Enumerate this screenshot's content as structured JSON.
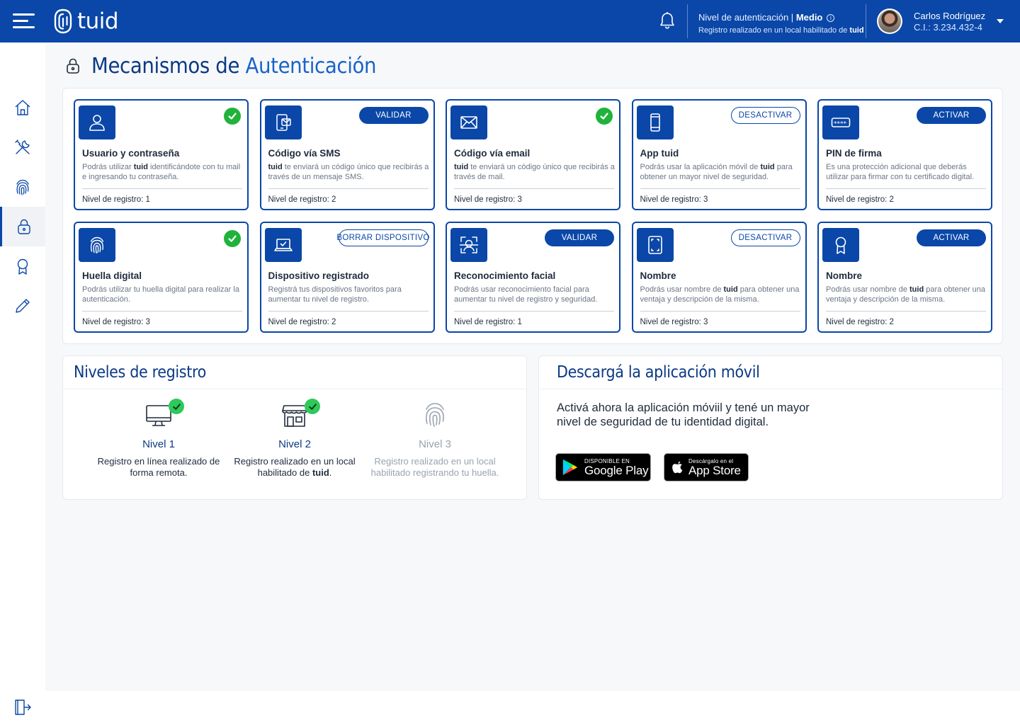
{
  "header": {
    "logo_text": "tuid",
    "auth_level_label": "Nivel de autenticación |",
    "auth_level_value": "Medio",
    "register_note": "Registro realizado en un local habilitado de",
    "register_note_brand": "tuid",
    "user_name": "Carlos Rodríguez",
    "user_ci": "C.I.: 3.234.432-4"
  },
  "page": {
    "title_a": "Mecanismos de",
    "title_b": "Autenticación"
  },
  "mechanisms": [
    {
      "title": "Usuario y contraseña",
      "desc_pre": "Podrás utilizar",
      "desc_brand": "tuid",
      "desc_post": "identificándote con tu mail e ingresando tu contraseña.",
      "level": "Nivel de registro: 1",
      "status": "check",
      "icon": "user-icon"
    },
    {
      "title": "Código vía SMS",
      "desc_pre": "",
      "desc_brand": "tuid",
      "desc_post": "te enviará un código único que recibirás a través de un mensaje SMS.",
      "level": "Nivel de registro: 2",
      "status": "VALIDAR",
      "icon": "sms-icon"
    },
    {
      "title": "Código vía email",
      "desc_pre": "",
      "desc_brand": "tuid",
      "desc_post": "te enviará un código único que recibirás a través de mail.",
      "level": "Nivel de registro: 3",
      "status": "check",
      "icon": "mail-icon"
    },
    {
      "title": "App tuid",
      "desc_pre": "Podrás usar la aplicación móvil de",
      "desc_brand": "tuid",
      "desc_post": "para obtener un mayor nivel de seguridad.",
      "level": "Nivel de registro: 3",
      "status": "DESACTIVAR",
      "icon": "phone-icon"
    },
    {
      "title": "PIN de firma",
      "desc_pre": "Es una protección adicional que deberás utilizar para firmar con tu certificado digital.",
      "desc_brand": "",
      "desc_post": "",
      "level": "Nivel de registro: 2",
      "status": "ACTIVAR",
      "icon": "pin-icon"
    },
    {
      "title": "Huella digital",
      "desc_pre": "Podrás utilizar tu huella digital para realizar la autenticación.",
      "desc_brand": "",
      "desc_post": "",
      "level": "Nivel de registro: 3",
      "status": "check",
      "icon": "fingerprint-icon"
    },
    {
      "title": "Dispositivo registrado",
      "desc_pre": "Registrá tus dispositivos favoritos para aumentar tu nivel de registro.",
      "desc_brand": "",
      "desc_post": "",
      "level": "Nivel de registro: 2",
      "status": "BORRAR DISPOSITIVO",
      "icon": "laptop-icon"
    },
    {
      "title": "Reconocimiento facial",
      "desc_pre": "Podrás usar reconocimiento facial para aumentar tu nivel de registro y seguridad.",
      "desc_brand": "",
      "desc_post": "",
      "level": "Nivel de registro: 1",
      "status": "VALIDAR",
      "icon": "face-scan-icon"
    },
    {
      "title": "Nombre",
      "desc_pre": "Podrás usar nombre de",
      "desc_brand": "tuid",
      "desc_post": "para obtener una ventaja y descripción de la misma.",
      "level": "Nivel de registro: 3",
      "status": "DESACTIVAR",
      "icon": "tablet-icon"
    },
    {
      "title": "Nombre",
      "desc_pre": "Podrás usar nombre de",
      "desc_brand": "tuid",
      "desc_post": "para obtener una ventaja y descripción de la misma.",
      "level": "Nivel de registro: 2",
      "status": "ACTIVAR",
      "icon": "badge-icon"
    }
  ],
  "levels_panel": {
    "title": "Niveles de registro",
    "levels": [
      {
        "name": "Nivel 1",
        "desc": "Registro en línea realizado de forma remota.",
        "done": true
      },
      {
        "name": "Nivel 2",
        "desc_pre": "Registro realizado en un local habilitado de",
        "desc_brand": "tuid",
        "desc_post": ".",
        "done": true
      },
      {
        "name": "Nivel 3",
        "desc": "Registro realizado en un local habilitado registrando tu huella.",
        "done": false
      }
    ]
  },
  "download_panel": {
    "title": "Descargá la aplicación móvil",
    "text": "Activá ahora la aplicación móviil y tené un mayor nivel de seguridad de tu identidad digital.",
    "google_small": "DISPONIBLE EN",
    "google_big": "Google Play",
    "apple_small": "Descárgalo en el",
    "apple_big": "App Store"
  },
  "colors": {
    "brand": "#0a47a8",
    "check": "#1fb33a",
    "title": "#0b3a85"
  }
}
